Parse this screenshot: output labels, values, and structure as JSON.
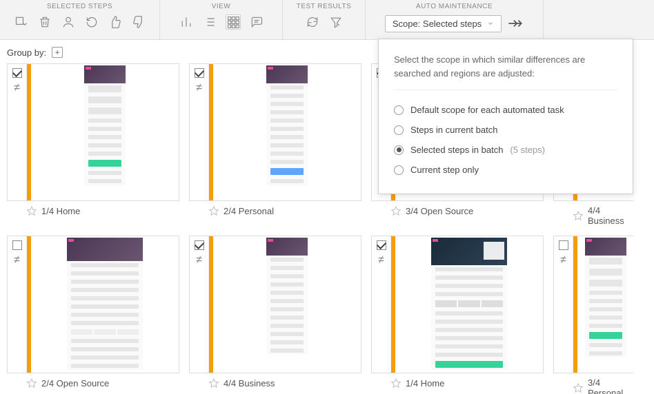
{
  "toolbar": {
    "sections": {
      "selected": "SELECTED STEPS",
      "view": "VIEW",
      "results": "TEST RESULTS",
      "auto": "AUTO MAINTENANCE"
    },
    "scope_label": "Scope: Selected steps"
  },
  "groupby": {
    "label": "Group by:"
  },
  "popover": {
    "description": "Select the scope in which similar differences are searched and regions are adjusted:",
    "options": [
      {
        "label": "Default scope for each automated task",
        "selected": false
      },
      {
        "label": "Steps in current batch",
        "selected": false
      },
      {
        "label": "Selected steps in batch",
        "hint": "(5 steps)",
        "selected": true
      },
      {
        "label": "Current step only",
        "selected": false
      }
    ]
  },
  "cards": [
    {
      "checked": true,
      "caption": "1/4 Home",
      "variant": "narrow-green"
    },
    {
      "checked": true,
      "caption": "2/4 Personal",
      "variant": "narrow-blue"
    },
    {
      "checked": true,
      "caption": "3/4 Open Source",
      "variant": "narrow-orange"
    },
    {
      "checked": true,
      "caption": "4/4 Business",
      "variant": "narrow-green",
      "half": true
    },
    {
      "checked": false,
      "caption": "2/4 Open Source",
      "variant": "wide"
    },
    {
      "checked": true,
      "caption": "4/4 Business",
      "variant": "narrow-mixed"
    },
    {
      "checked": true,
      "caption": "1/4 Home",
      "variant": "wide-dark"
    },
    {
      "checked": false,
      "caption": "3/4 Personal",
      "variant": "narrow-green",
      "half": true
    }
  ]
}
